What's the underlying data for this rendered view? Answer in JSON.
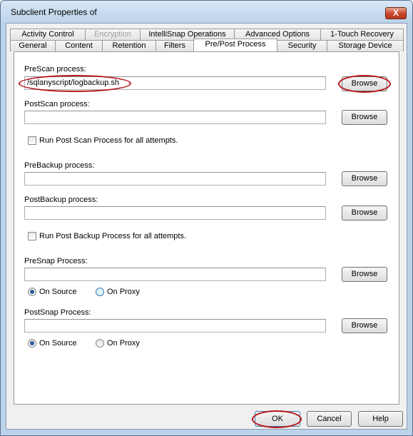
{
  "window": {
    "title": "Subclient Properties of",
    "close_glyph": "X"
  },
  "tabs_row1": [
    {
      "label": "Activity Control",
      "disabled": false
    },
    {
      "label": "Encryption",
      "disabled": true
    },
    {
      "label": "IntelliSnap Operations",
      "disabled": false
    },
    {
      "label": "Advanced Options",
      "disabled": false
    },
    {
      "label": "1-Touch Recovery",
      "disabled": false
    }
  ],
  "tabs_row2": [
    {
      "label": "General"
    },
    {
      "label": "Content"
    },
    {
      "label": "Retention"
    },
    {
      "label": "Filters"
    },
    {
      "label": "Pre/Post Process",
      "active": true
    },
    {
      "label": "Security"
    },
    {
      "label": "Storage Device"
    }
  ],
  "prescan": {
    "label": "PreScan process:",
    "value": "/sqlanyscript/logbackup.sh",
    "browse_label": "Browse"
  },
  "postscan": {
    "label": "PostScan process:",
    "value": "",
    "browse_label": "Browse",
    "checkbox_label": "Run Post Scan Process for all attempts.",
    "checked": false
  },
  "prebackup": {
    "label": "PreBackup process:",
    "value": "",
    "browse_label": "Browse"
  },
  "postbackup": {
    "label": "PostBackup process:",
    "value": "",
    "browse_label": "Browse",
    "checkbox_label": "Run Post Backup Process for all attempts.",
    "checked": false
  },
  "presnap": {
    "label": "PreSnap Process:",
    "value": "",
    "browse_label": "Browse",
    "radio_source": "On Source",
    "radio_proxy": "On Proxy",
    "selected": "source"
  },
  "postsnap": {
    "label": "PostSnap Process:",
    "value": "",
    "browse_label": "Browse",
    "radio_source": "On Source",
    "radio_proxy": "On Proxy",
    "selected": "source"
  },
  "footer": {
    "ok_label": "OK",
    "cancel_label": "Cancel",
    "help_label": "Help"
  },
  "colors": {
    "annotation": "#b8151b",
    "window_frame": "#bcd3ea",
    "panel_bg": "#ffffff"
  }
}
